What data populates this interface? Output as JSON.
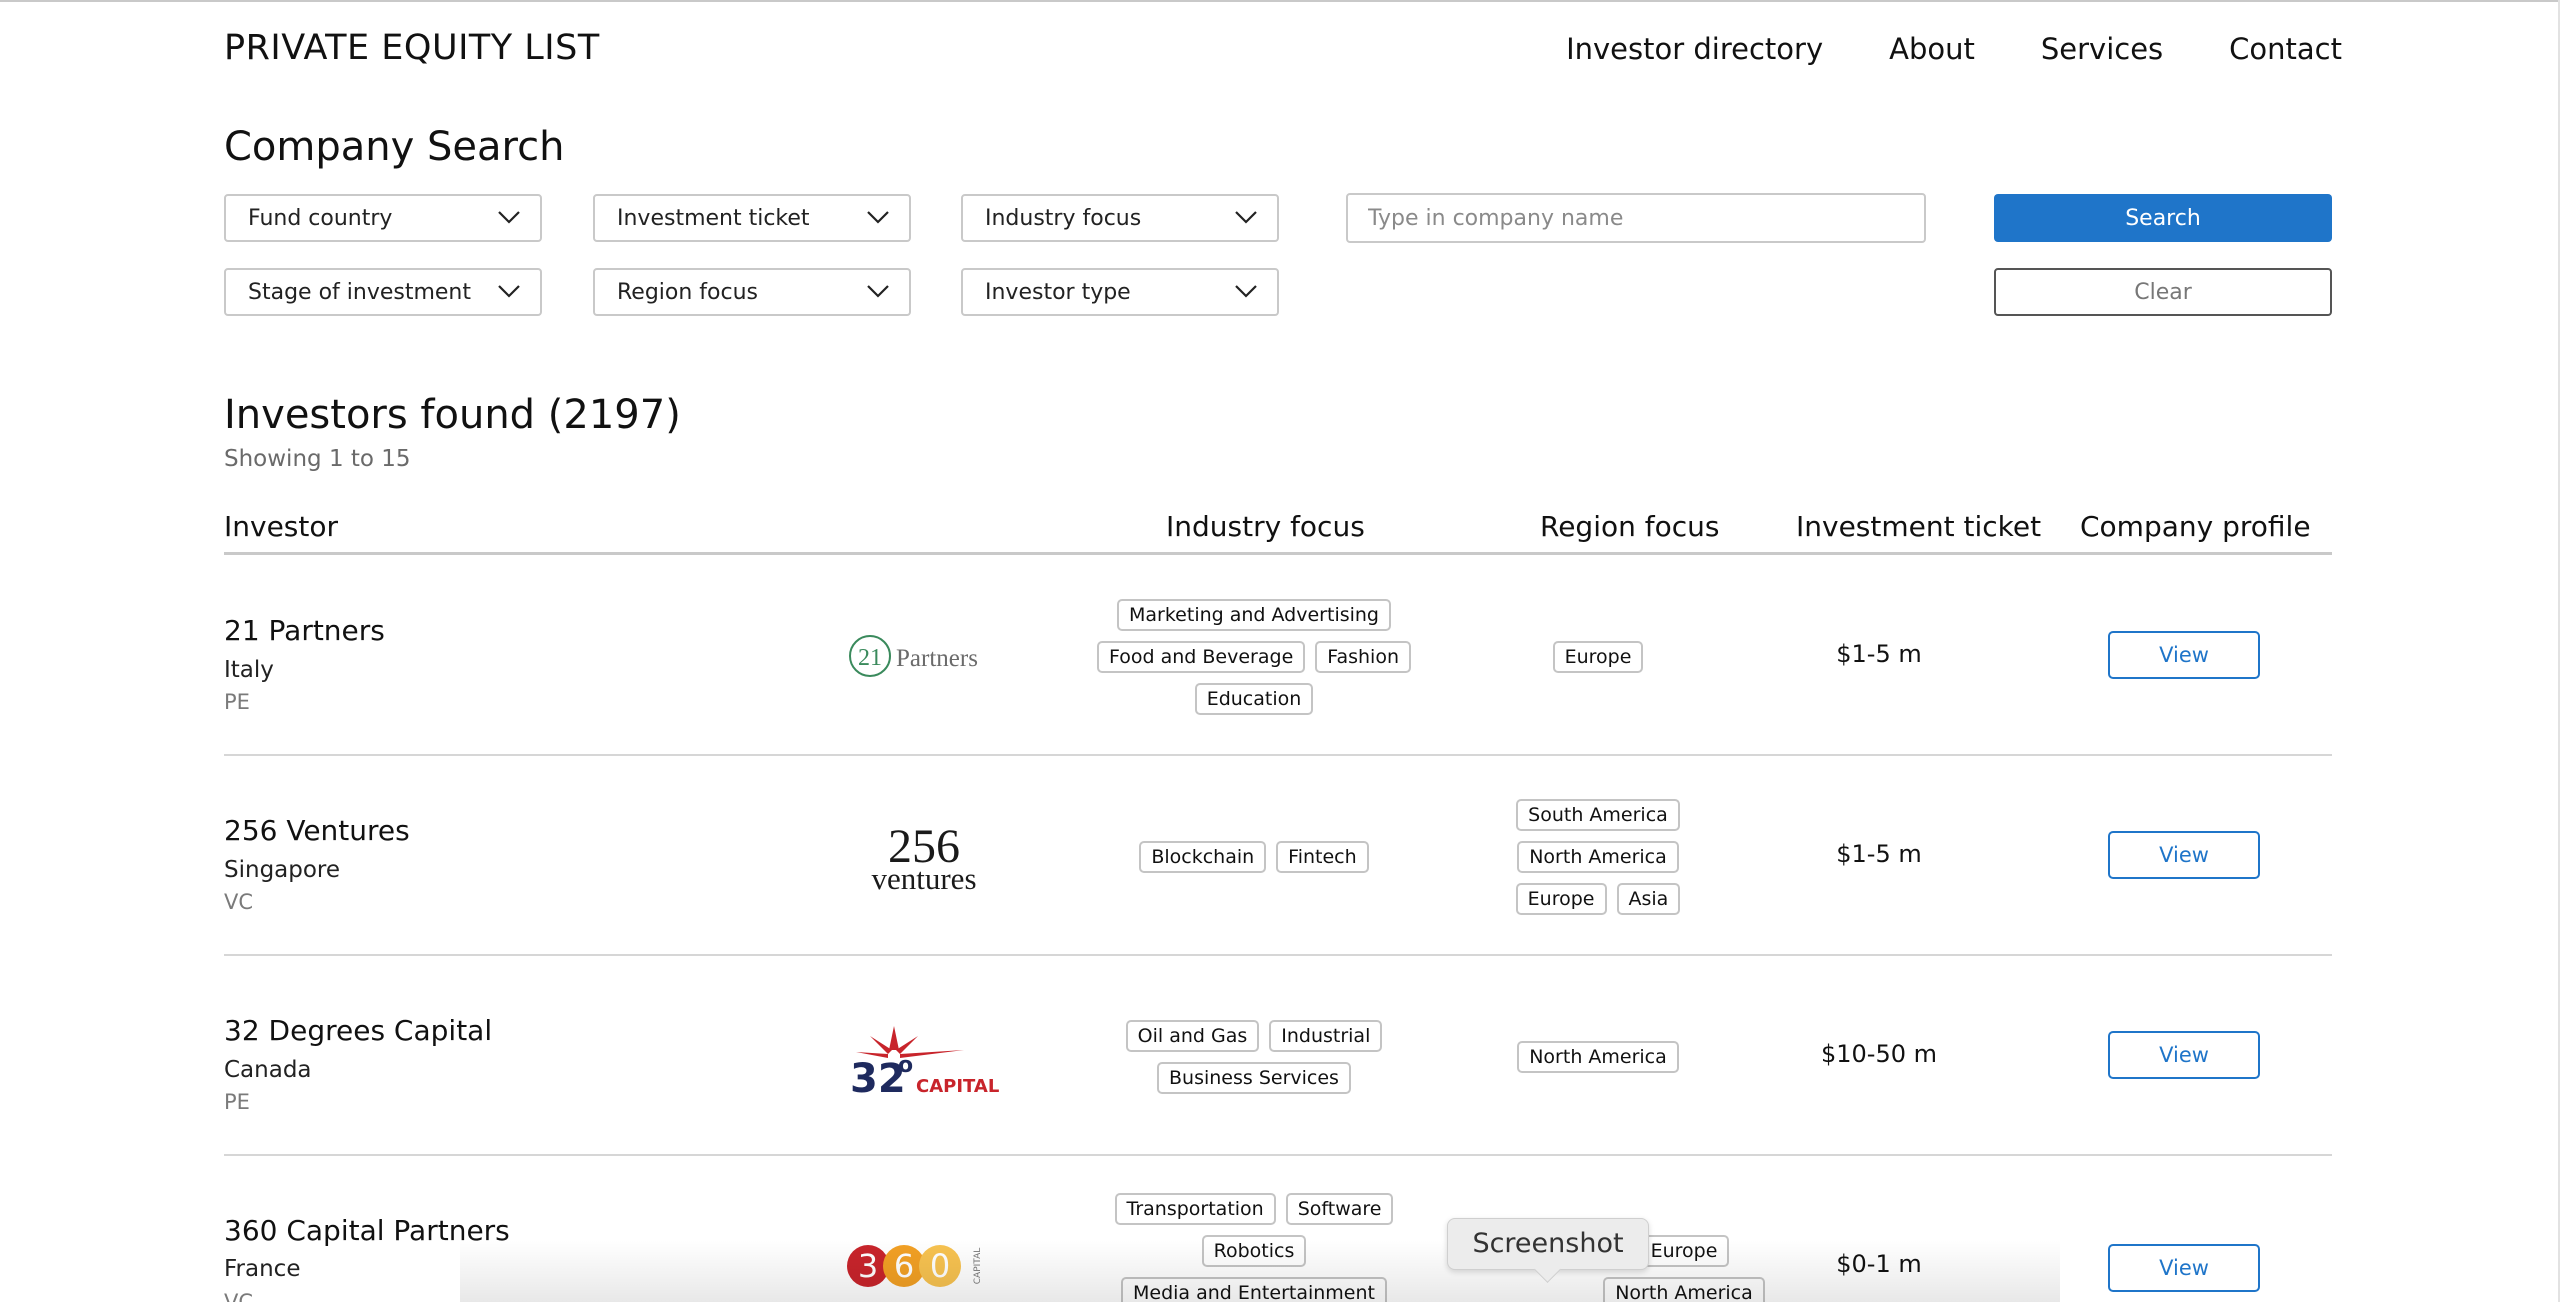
{
  "header": {
    "brand": "PRIVATE EQUITY LIST",
    "nav": [
      "Investor directory",
      "About",
      "Services",
      "Contact"
    ]
  },
  "search": {
    "title": "Company Search",
    "filters_row1": [
      "Fund country",
      "Investment ticket",
      "Industry focus"
    ],
    "filters_row2": [
      "Stage of investment",
      "Region focus",
      "Investor type"
    ],
    "company_placeholder": "Type in company name",
    "search_label": "Search",
    "clear_label": "Clear"
  },
  "results": {
    "title": "Investors found (2197)",
    "subtitle": "Showing 1 to 15",
    "columns": [
      "Investor",
      "Industry focus",
      "Region focus",
      "Investment ticket",
      "Company profile"
    ],
    "view_label": "View",
    "rows": [
      {
        "name": "21 Partners",
        "country": "Italy",
        "type": "PE",
        "logo_text": [
          "21",
          "Partners"
        ],
        "industry": [
          "Marketing and Advertising",
          "Food and Beverage",
          "Fashion",
          "Education"
        ],
        "region": [
          "Europe"
        ],
        "ticket": "$1-5 m"
      },
      {
        "name": "256 Ventures",
        "country": "Singapore",
        "type": "VC",
        "logo_text": [
          "256",
          "ventures"
        ],
        "industry": [
          "Blockchain",
          "Fintech"
        ],
        "region": [
          "South America",
          "North America",
          "Europe",
          "Asia"
        ],
        "ticket": "$1-5 m"
      },
      {
        "name": "32 Degrees Capital",
        "country": "Canada",
        "type": "PE",
        "logo_text": [
          "32",
          "o",
          "CAPITAL"
        ],
        "industry": [
          "Oil and Gas",
          "Industrial",
          "Business Services"
        ],
        "region": [
          "North America"
        ],
        "ticket": "$10-50 m"
      },
      {
        "name": "360 Capital Partners",
        "country": "France",
        "type": "VC",
        "logo_text": [
          "3",
          "6",
          "0",
          "CAPITAL"
        ],
        "industry": [
          "Transportation",
          "Software",
          "Robotics",
          "Media and Entertainment"
        ],
        "region": [
          "Europe",
          "North America"
        ],
        "ticket": "$0-1 m"
      }
    ]
  },
  "tooltip": {
    "label": "Screenshot"
  },
  "colors": {
    "accent": "#1f75c9",
    "logo_red": "#c8242b",
    "logo_navy": "#1e2a5e",
    "logo_orange": "#f2a024",
    "logo_green": "#3a8a5c"
  }
}
